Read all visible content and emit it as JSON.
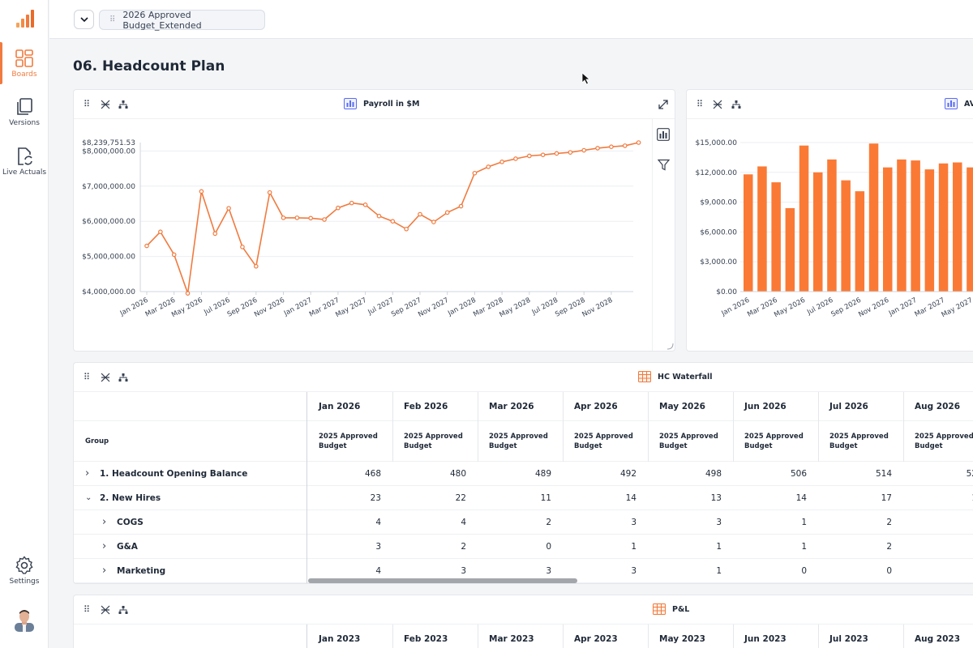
{
  "app": {
    "sidebar": {
      "items": [
        {
          "label": "Boards",
          "icon": "boards-icon"
        },
        {
          "label": "Versions",
          "icon": "versions-icon"
        },
        {
          "label": "Live Actuals",
          "icon": "live-actuals-icon"
        },
        {
          "label": "Settings",
          "icon": "settings-icon"
        }
      ]
    },
    "topbar": {
      "version_name": "2026 Approved Budget_Extended"
    },
    "page_title": "06. Headcount Plan",
    "accent": "#f07b3f"
  },
  "payroll_card": {
    "title": "Payroll in $M",
    "chart_data": {
      "type": "line",
      "title": "Payroll in $M",
      "y_ticks": [
        "$4,000,000.00",
        "$5,000,000.00",
        "$6,000,000.00",
        "$7,000,000.00",
        "$8,000,000.00"
      ],
      "y_max_label": "$8,239,751.53",
      "ylim": [
        4000000,
        8239751.53
      ],
      "x_tick_labels": [
        "Jan 2026",
        "Mar 2026",
        "May 2026",
        "Jul 2026",
        "Sep 2026",
        "Nov 2026",
        "Jan 2027",
        "Mar 2027",
        "May 2027",
        "Jul 2027",
        "Sep 2027",
        "Nov 2027",
        "Jan 2028",
        "Mar 2028",
        "May 2028",
        "Jul 2028",
        "Sep 2028",
        "Nov 2028"
      ],
      "series": [
        {
          "values": [
            5300000,
            5700000,
            5050000,
            3950000,
            6850000,
            5650000,
            6370000,
            5270000,
            4720000,
            6820000,
            6100000,
            6100000,
            6090000,
            6050000,
            6380000,
            6520000,
            6470000,
            6150000,
            6000000,
            5780000,
            6200000,
            5980000,
            6250000,
            6430000,
            7370000,
            7550000,
            7690000,
            7780000,
            7860000,
            7890000,
            7930000,
            7960000,
            8020000,
            8080000,
            8120000,
            8150000,
            8239751
          ]
        }
      ],
      "color": "#f07b3f"
    }
  },
  "avg_card": {
    "title": "AVG",
    "chart_data": {
      "type": "bar",
      "y_ticks": [
        "$0.00",
        "$3,000.00",
        "$6,000.00",
        "$9,000.00",
        "$12,000.00",
        "$15,000.00"
      ],
      "ylim": [
        0,
        15000
      ],
      "x_tick_labels": [
        "Jan 2026",
        "Mar 2026",
        "May 2026",
        "Jul 2026",
        "Sep 2026",
        "Nov 2026",
        "Jan 2027",
        "Mar 2027",
        "May 2027"
      ],
      "values": [
        11800,
        12600,
        11000,
        8400,
        14700,
        12000,
        13300,
        11200,
        10100,
        14900,
        12500,
        13300,
        13200,
        12300,
        12900,
        13000,
        12500
      ],
      "color": "#fa7a35"
    }
  },
  "waterfall_card": {
    "title": "HC Waterfall",
    "group_header": "Group",
    "months": [
      "Jan 2026",
      "Feb 2026",
      "Mar 2026",
      "Apr 2026",
      "May 2026",
      "Jun 2026",
      "Jul 2026",
      "Aug 2026"
    ],
    "sub_header": "2025 Approved Budget",
    "rows": [
      {
        "label": "1. Headcount Opening Balance",
        "level": 0,
        "expanded": false,
        "values": [
          "468",
          "480",
          "489",
          "492",
          "498",
          "506",
          "514",
          "52"
        ]
      },
      {
        "label": "2. New Hires",
        "level": 0,
        "expanded": true,
        "values": [
          "23",
          "22",
          "11",
          "14",
          "13",
          "14",
          "17",
          "1"
        ]
      },
      {
        "label": "COGS",
        "level": 1,
        "expanded": false,
        "values": [
          "4",
          "4",
          "2",
          "3",
          "3",
          "1",
          "2",
          ""
        ]
      },
      {
        "label": "G&A",
        "level": 1,
        "expanded": false,
        "values": [
          "3",
          "2",
          "0",
          "1",
          "1",
          "1",
          "2",
          ""
        ]
      },
      {
        "label": "Marketing",
        "level": 1,
        "expanded": false,
        "values": [
          "4",
          "3",
          "3",
          "3",
          "1",
          "0",
          "0",
          ""
        ]
      }
    ]
  },
  "pl_card": {
    "title": "P&L",
    "months": [
      "Jan 2023",
      "Feb 2023",
      "Mar 2023",
      "Apr 2023",
      "May 2023",
      "Jun 2023",
      "Jul 2023",
      "Aug 2023"
    ]
  }
}
